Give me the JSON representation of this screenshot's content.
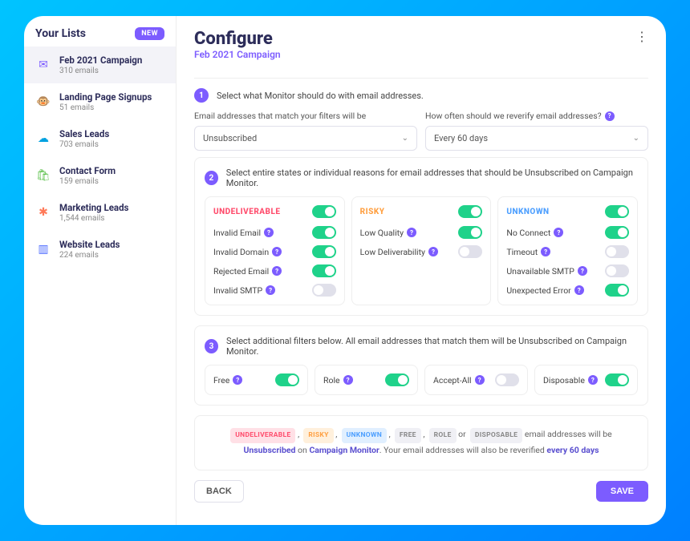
{
  "sidebar": {
    "title": "Your Lists",
    "new_badge": "NEW",
    "items": [
      {
        "label": "Feb 2021 Campaign",
        "sub": "310 emails",
        "icon": "✉",
        "icon_color": "#7c5cff",
        "active": true
      },
      {
        "label": "Landing Page Signups",
        "sub": "51 emails",
        "icon": "🐵",
        "icon_color": "#222",
        "active": false
      },
      {
        "label": "Sales Leads",
        "sub": "703 emails",
        "icon": "☁",
        "icon_color": "#00a1e0",
        "active": false
      },
      {
        "label": "Contact Form",
        "sub": "159 emails",
        "icon": "🛍",
        "icon_color": "#5ec14e",
        "active": false
      },
      {
        "label": "Marketing Leads",
        "sub": "1,544 emails",
        "icon": "✱",
        "icon_color": "#ff7a59",
        "active": false
      },
      {
        "label": "Website Leads",
        "sub": "224 emails",
        "icon": "▥",
        "icon_color": "#4d6bff",
        "active": false
      }
    ]
  },
  "header": {
    "title": "Configure",
    "subtitle": "Feb 2021 Campaign"
  },
  "step1": {
    "num": "1",
    "text": "Select what Monitor should do with email addresses.",
    "field1_label": "Email addresses that match your filters will be",
    "field1_value": "Unsubscribed",
    "field2_label": "How often should we reverify email addresses?",
    "field2_value": "Every 60 days"
  },
  "step2": {
    "num": "2",
    "text": "Select entire states or individual reasons for email addresses that should be Unsubscribed on Campaign Monitor.",
    "cards": [
      {
        "title": "UNDELIVERABLE",
        "title_class": "t-undeliverable",
        "on": true,
        "opts": [
          {
            "label": "Invalid Email",
            "on": true
          },
          {
            "label": "Invalid Domain",
            "on": true
          },
          {
            "label": "Rejected Email",
            "on": true
          },
          {
            "label": "Invalid SMTP",
            "on": false
          }
        ]
      },
      {
        "title": "RISKY",
        "title_class": "t-risky",
        "on": true,
        "opts": [
          {
            "label": "Low Quality",
            "on": true
          },
          {
            "label": "Low Deliverability",
            "on": false
          }
        ]
      },
      {
        "title": "UNKNOWN",
        "title_class": "t-unknown",
        "on": true,
        "opts": [
          {
            "label": "No Connect",
            "on": true
          },
          {
            "label": "Timeout",
            "on": false
          },
          {
            "label": "Unavailable SMTP",
            "on": false
          },
          {
            "label": "Unexpected Error",
            "on": true
          }
        ]
      }
    ]
  },
  "step3": {
    "num": "3",
    "text": "Select additional filters below. All email addresses that match them will be Unsubscribed on Campaign Monitor.",
    "filters": [
      {
        "label": "Free",
        "on": true
      },
      {
        "label": "Role",
        "on": true
      },
      {
        "label": "Accept-All",
        "on": false
      },
      {
        "label": "Disposable",
        "on": true
      }
    ]
  },
  "summary": {
    "chips": [
      {
        "text": "UNDELIVERABLE",
        "class": "chip-undeliverable"
      },
      {
        "text": "RISKY",
        "class": "chip-risky"
      },
      {
        "text": "UNKNOWN",
        "class": "chip-unknown"
      },
      {
        "text": "FREE",
        "class": "chip-gray"
      },
      {
        "text": "ROLE",
        "class": "chip-gray"
      },
      {
        "text": "DISPOSABLE",
        "class": "chip-gray"
      }
    ],
    "sep_comma": ",",
    "sep_or": "or",
    "tail1": " email addresses will be ",
    "action": "Unsubscribed",
    "tail2": " on ",
    "platform": "Campaign Monitor",
    "tail3": ". Your email addresses will also be reverified ",
    "freq": "every 60 days"
  },
  "footer": {
    "back": "BACK",
    "save": "SAVE"
  }
}
